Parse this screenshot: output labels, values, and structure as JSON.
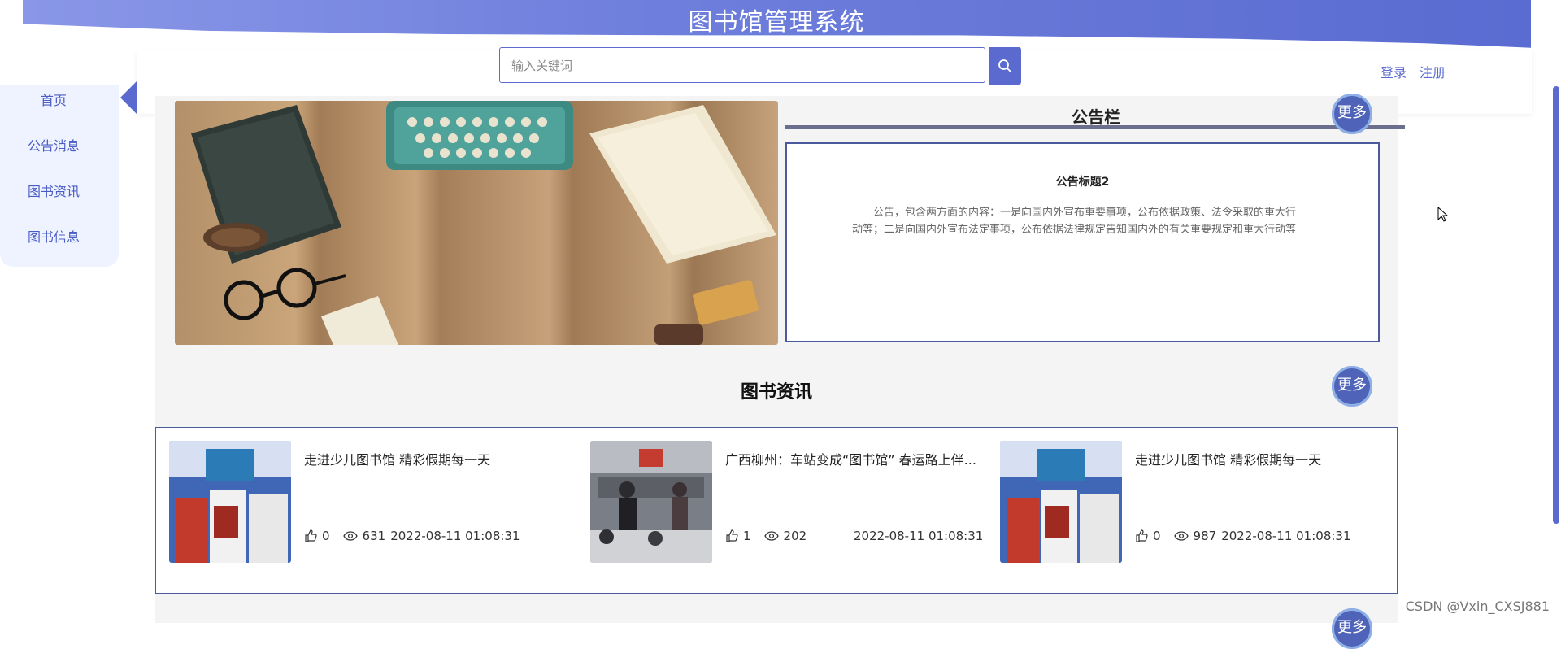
{
  "header": {
    "site_title": "图书馆管理系统",
    "search_placeholder": "输入关键词",
    "login_label": "登录",
    "register_label": "注册"
  },
  "sidebar": {
    "items": [
      {
        "label": "首页",
        "active": true
      },
      {
        "label": "公告消息"
      },
      {
        "label": "图书资讯"
      },
      {
        "label": "图书信息"
      }
    ]
  },
  "notice": {
    "heading": "公告栏",
    "more_label": "更多",
    "item_title": "公告标题2",
    "item_body": "公告，包含两方面的内容：一是向国内外宣布重要事项，公布依据政策、法令采取的重大行动等；二是向国内外宣布法定事项，公布依据法律规定告知国内外的有关重要规定和重大行动等"
  },
  "news": {
    "heading": "图书资讯",
    "more_label": "更多",
    "items": [
      {
        "title": "走进少儿图书馆 精彩假期每一天",
        "likes": "0",
        "views": "631",
        "date": "2022-08-11 01:08:31"
      },
      {
        "title": "广西柳州：车站变成“图书馆” 春运路上伴...",
        "likes": "1",
        "views": "202",
        "date": "2022-08-11 01:08:31"
      },
      {
        "title": "走进少儿图书馆 精彩假期每一天",
        "likes": "0",
        "views": "987",
        "date": "2022-08-11 01:08:31"
      }
    ]
  },
  "next_section": {
    "more_label": "更多"
  },
  "watermark": "CSDN @Vxin_CXSJ881",
  "colors": {
    "accent": "#5b6acf",
    "brand_dark": "#4a5a9c"
  },
  "icons": [
    "search-icon",
    "like-icon",
    "eye-icon",
    "mouse-cursor-icon"
  ]
}
